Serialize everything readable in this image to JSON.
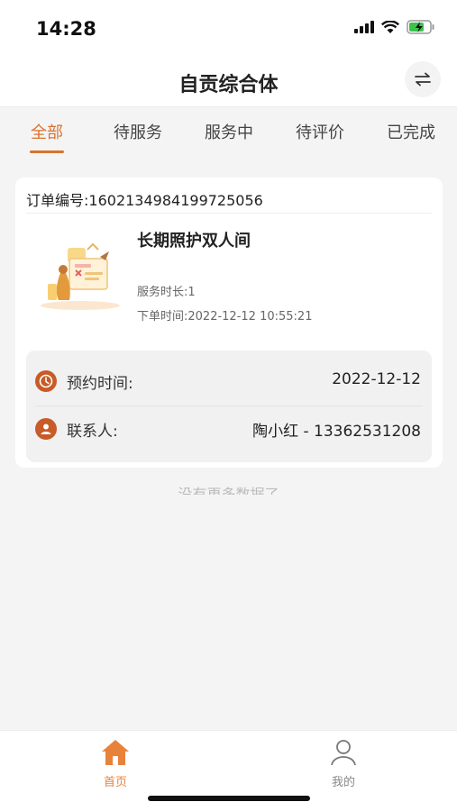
{
  "status_bar": {
    "time": "14:28",
    "icons": [
      "signal-icon",
      "wifi-icon",
      "battery-icon"
    ]
  },
  "header": {
    "title": "自贡综合体",
    "switch_icon": "swap-icon"
  },
  "tabs": [
    {
      "label": "全部",
      "active": true
    },
    {
      "label": "待服务",
      "active": false
    },
    {
      "label": "服务中",
      "active": false
    },
    {
      "label": "待评价",
      "active": false
    },
    {
      "label": "已完成",
      "active": false
    }
  ],
  "orders": [
    {
      "order_no_label": "订单编号:",
      "order_no": "1602134984199725056",
      "service_name": "长期照护双人间",
      "duration_label": "服务时长:",
      "duration": "1",
      "order_time_label": "下单时间:",
      "order_time": "2022-12-12 10:55:21",
      "appointment_label": "预约时间:",
      "appointment": "2022-12-12",
      "contact_label": "联系人:",
      "contact": "陶小红 - 13362531208"
    }
  ],
  "list_footer": "没有更多数据了",
  "bottom_nav": [
    {
      "label": "首页",
      "icon": "home-icon",
      "active": true
    },
    {
      "label": "我的",
      "icon": "user-icon",
      "active": false
    }
  ],
  "colors": {
    "accent": "#d9722f",
    "icon_bg": "#c85b27",
    "background": "#f4f4f4"
  }
}
